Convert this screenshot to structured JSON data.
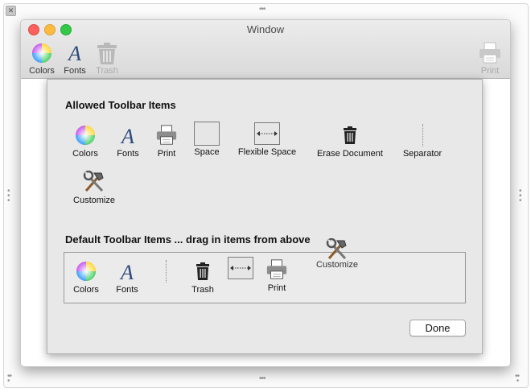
{
  "window": {
    "title": "Window"
  },
  "toolbar": {
    "colors_label": "Colors",
    "fonts_label": "Fonts",
    "trash_label": "Trash",
    "print_label": "Print"
  },
  "sheet": {
    "allowed_title": "Allowed Toolbar Items",
    "allowed_items": [
      {
        "label": "Colors",
        "icon": "color-wheel-icon"
      },
      {
        "label": "Fonts",
        "icon": "font-icon"
      },
      {
        "label": "Print",
        "icon": "printer-icon"
      },
      {
        "label": "Space",
        "icon": "space-icon"
      },
      {
        "label": "Flexible Space",
        "icon": "flexible-space-icon"
      },
      {
        "label": "Erase Document",
        "icon": "trash-icon"
      },
      {
        "label": "Separator",
        "icon": "separator-icon"
      },
      {
        "label": "Customize",
        "icon": "tools-icon"
      }
    ],
    "default_title": "Default Toolbar Items ... drag in items from above",
    "default_items": [
      {
        "label": "Colors",
        "icon": "color-wheel-icon"
      },
      {
        "label": "Fonts",
        "icon": "font-icon"
      },
      {
        "label": "",
        "icon": "separator-icon"
      },
      {
        "label": "Trash",
        "icon": "trash-icon"
      },
      {
        "label": "",
        "icon": "flexible-space-icon"
      },
      {
        "label": "Print",
        "icon": "printer-icon"
      }
    ],
    "dragging_item": {
      "label": "Customize",
      "icon": "tools-icon"
    },
    "done_label": "Done"
  },
  "colors": {
    "close": "#fc605c",
    "minimize": "#fdbc40",
    "zoom": "#34c84a",
    "sheet_bg": "#e8e8e8",
    "window_bg": "#ffffff"
  }
}
